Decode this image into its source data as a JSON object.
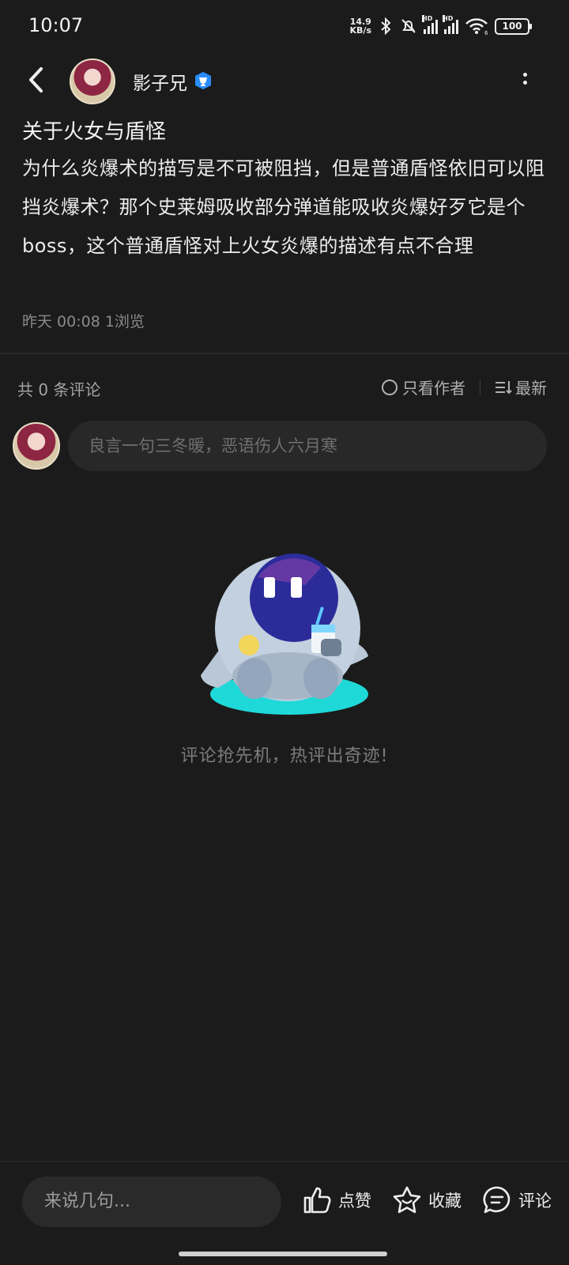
{
  "status_bar": {
    "time": "10:07",
    "net_speed_value": "14.9",
    "net_speed_unit": "KB/s",
    "signal_label_1": "HD",
    "signal_label_2": "HD",
    "wifi_label": "6",
    "battery": "100"
  },
  "header": {
    "username": "影子兄",
    "back_icon": "chevron-left-icon",
    "verify_icon": "verified-badge-icon",
    "more_icon": "more-vertical-icon"
  },
  "post": {
    "title": "关于火女与盾怪",
    "body": "为什么炎爆术的描写是不可被阻挡，但是普通盾怪依旧可以阻挡炎爆术？那个史莱姆吸收部分弹道能吸收炎爆好歹它是个boss，这个普通盾怪对上火女炎爆的描述有点不合理",
    "meta": "昨天 00:08  1浏览"
  },
  "comments": {
    "count_label": "共 0 条评论",
    "author_only": "只看作者",
    "sort_label": "最新",
    "input_placeholder": "良言一句三冬暖，恶语伤人六月寒",
    "empty_text": "评论抢先机，热评出奇迹!"
  },
  "bottom_bar": {
    "input_placeholder": "来说几句...",
    "like_label": "点赞",
    "favorite_label": "收藏",
    "comment_label": "评论"
  },
  "colors": {
    "background": "#1b1b1b",
    "verify_badge": "#2a8cff",
    "mascot_teal": "#1fd8d8",
    "mascot_face": "#2b2c9a"
  }
}
